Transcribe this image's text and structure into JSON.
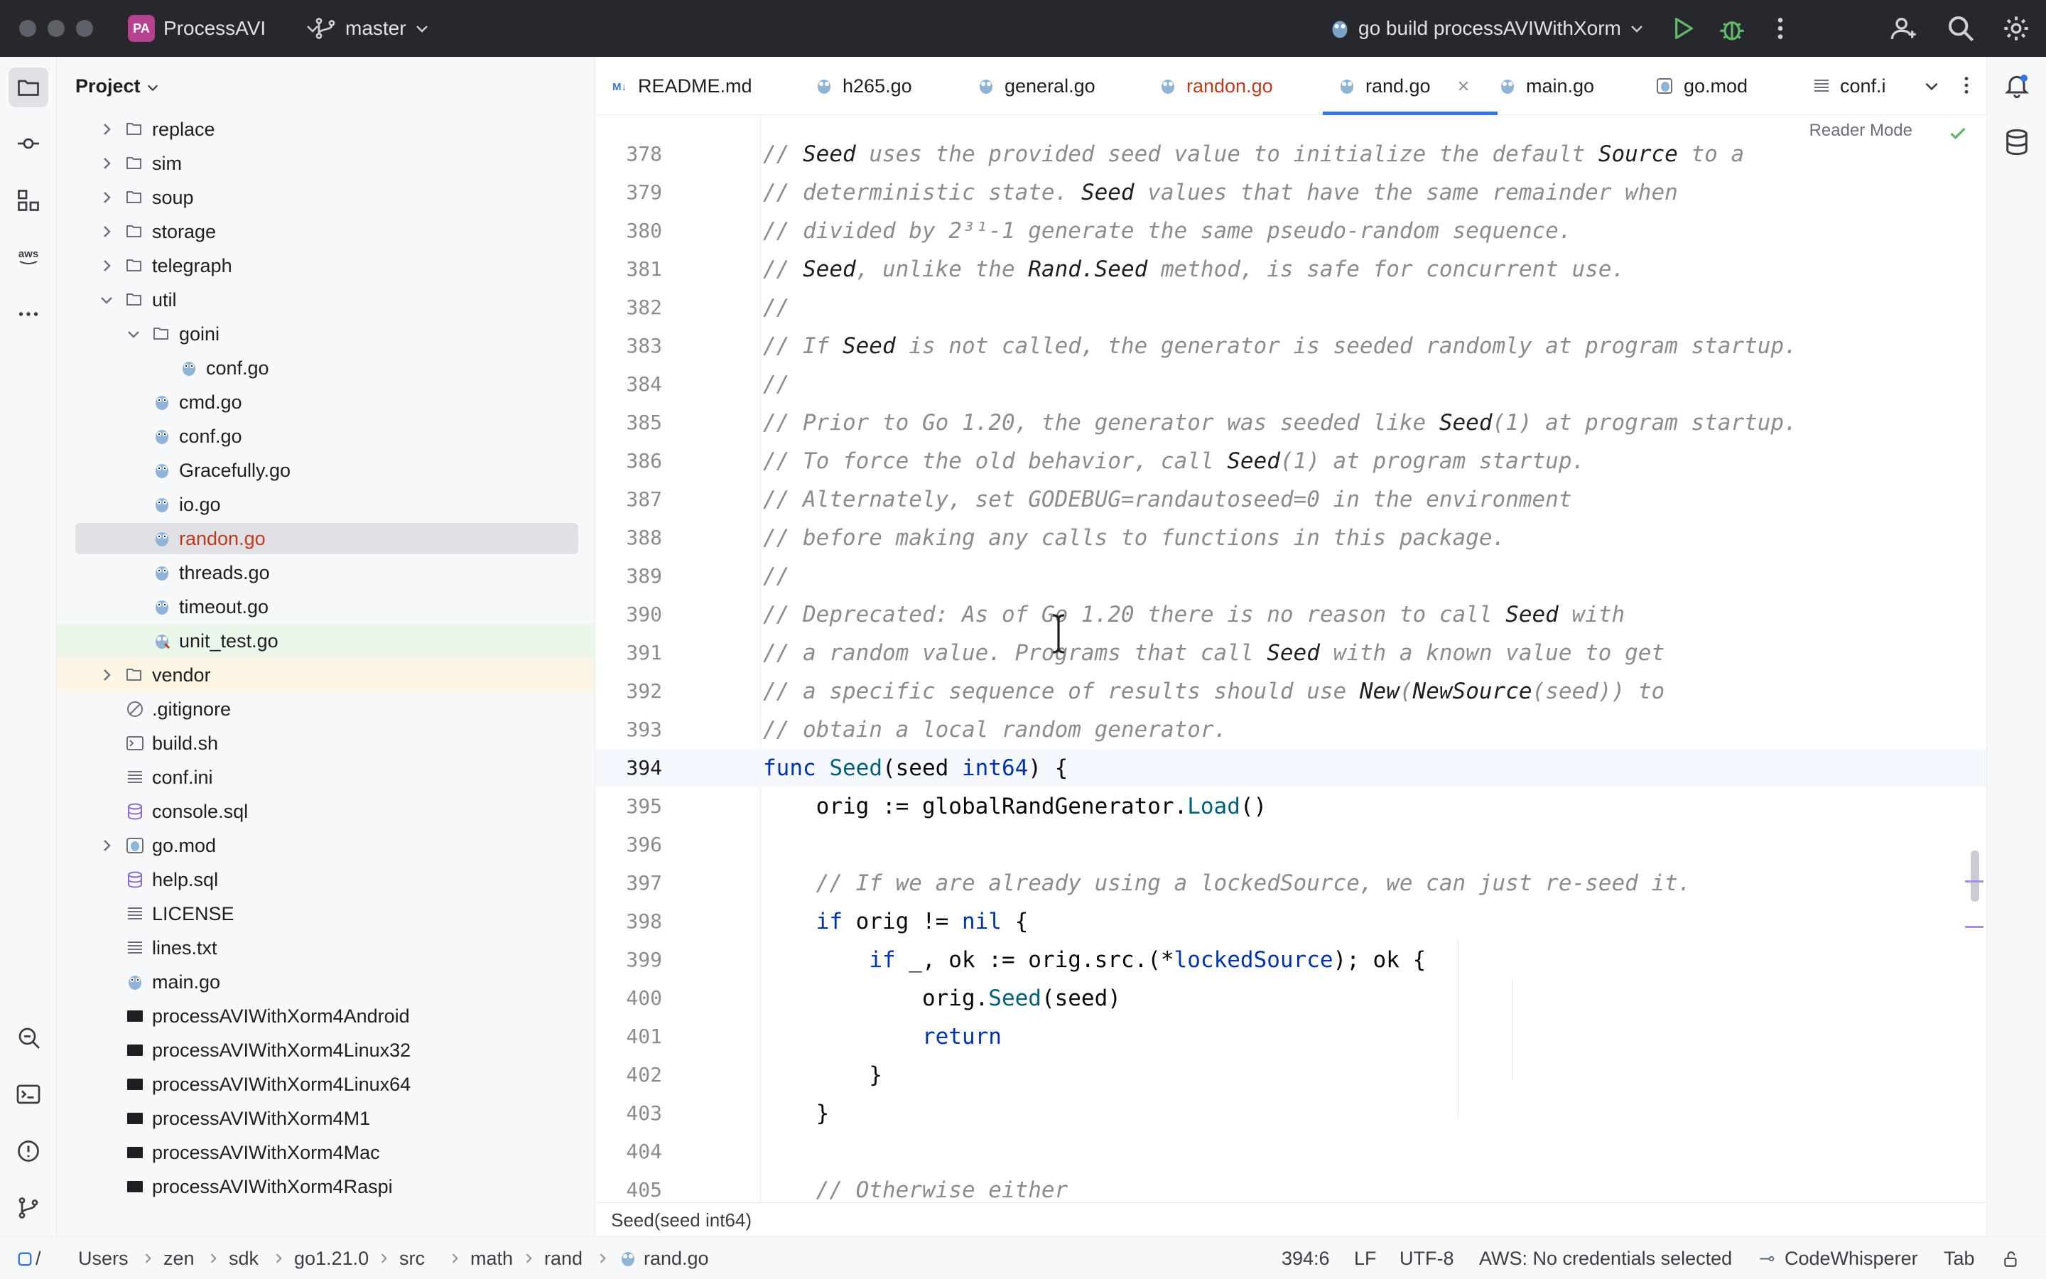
{
  "titlebar": {
    "project_badge": "PA",
    "project_name": "ProcessAVI",
    "branch": "master",
    "run_config": "go build processAVIWithXorm"
  },
  "project_panel": {
    "title": "Project",
    "items": [
      {
        "label": "replace"
      },
      {
        "label": "sim"
      },
      {
        "label": "soup"
      },
      {
        "label": "storage"
      },
      {
        "label": "telegraph"
      },
      {
        "label": "util"
      },
      {
        "label": "goini"
      },
      {
        "label": "conf.go"
      },
      {
        "label": "cmd.go"
      },
      {
        "label": "conf.go"
      },
      {
        "label": "Gracefully.go"
      },
      {
        "label": "io.go"
      },
      {
        "label": "randon.go"
      },
      {
        "label": "threads.go"
      },
      {
        "label": "timeout.go"
      },
      {
        "label": "unit_test.go"
      },
      {
        "label": "vendor"
      },
      {
        "label": ".gitignore"
      },
      {
        "label": "build.sh"
      },
      {
        "label": "conf.ini"
      },
      {
        "label": "console.sql"
      },
      {
        "label": "go.mod"
      },
      {
        "label": "help.sql"
      },
      {
        "label": "LICENSE"
      },
      {
        "label": "lines.txt"
      },
      {
        "label": "main.go"
      },
      {
        "label": "processAVIWithXorm4Android"
      },
      {
        "label": "processAVIWithXorm4Linux32"
      },
      {
        "label": "processAVIWithXorm4Linux64"
      },
      {
        "label": "processAVIWithXorm4M1"
      },
      {
        "label": "processAVIWithXorm4Mac"
      },
      {
        "label": "processAVIWithXorm4Raspi"
      }
    ]
  },
  "tabs": [
    {
      "label": "README.md"
    },
    {
      "label": "h265.go"
    },
    {
      "label": "general.go"
    },
    {
      "label": "randon.go"
    },
    {
      "label": "rand.go"
    },
    {
      "label": "main.go"
    },
    {
      "label": "go.mod"
    },
    {
      "label": "conf.i"
    }
  ],
  "editor": {
    "reader_mode": "Reader Mode",
    "lines": [
      {
        "n": "378"
      },
      {
        "n": "379"
      },
      {
        "n": "380"
      },
      {
        "n": "381"
      },
      {
        "n": "382"
      },
      {
        "n": "383"
      },
      {
        "n": "384"
      },
      {
        "n": "385"
      },
      {
        "n": "386"
      },
      {
        "n": "387"
      },
      {
        "n": "388"
      },
      {
        "n": "389"
      },
      {
        "n": "390"
      },
      {
        "n": "391"
      },
      {
        "n": "392"
      },
      {
        "n": "393"
      },
      {
        "n": "394"
      },
      {
        "n": "395"
      },
      {
        "n": "396"
      },
      {
        "n": "397"
      },
      {
        "n": "398"
      },
      {
        "n": "399"
      },
      {
        "n": "400"
      },
      {
        "n": "401"
      },
      {
        "n": "402"
      },
      {
        "n": "403"
      },
      {
        "n": "404"
      },
      {
        "n": "405"
      }
    ],
    "code": {
      "l378": [
        "// ",
        "Seed",
        " uses the provided seed value to initialize the default ",
        "Source",
        " to a"
      ],
      "l379": [
        "// deterministic state. ",
        "Seed",
        " values that have the same remainder when"
      ],
      "l380": [
        "// divided by 2³¹-1 generate the same pseudo-random sequence."
      ],
      "l381": [
        "// ",
        "Seed",
        ", unlike the ",
        "Rand.Seed",
        " method, is safe for concurrent use."
      ],
      "l382": [
        "//"
      ],
      "l383": [
        "// If ",
        "Seed",
        " is not called, the generator is seeded randomly at program startup."
      ],
      "l384": [
        "//"
      ],
      "l385": [
        "// Prior to Go 1.20, the generator was seeded like ",
        "Seed",
        "(1) at program startup."
      ],
      "l386": [
        "// To force the old behavior, call ",
        "Seed",
        "(1) at program startup."
      ],
      "l387": [
        "// Alternately, set GODEBUG=randautoseed=0 in the environment"
      ],
      "l388": [
        "// before making any calls to functions in this package."
      ],
      "l389": [
        "//"
      ],
      "l390": [
        "// Deprecated: As of Go 1.20 there is no reason to call ",
        "Seed",
        " with"
      ],
      "l391": [
        "// a random value. Programs that call ",
        "Seed",
        " with a known value to get"
      ],
      "l392": [
        "// a specific sequence of results should use ",
        "New",
        "(",
        "NewSource",
        "(seed)) to"
      ],
      "l393": [
        "// obtain a local random generator."
      ],
      "l394": [
        "func",
        " ",
        "Seed",
        "(seed ",
        "int64",
        ") {"
      ],
      "l395": [
        "    orig := globalRandGenerator.",
        "Load",
        "()"
      ],
      "l396": [
        ""
      ],
      "l397": [
        "    // If we are already using a lockedSource, we can just re-seed it."
      ],
      "l398": [
        "    ",
        "if",
        " orig != ",
        "nil",
        " {"
      ],
      "l399": [
        "        ",
        "if",
        " _, ok := orig.src.(*",
        "lockedSource",
        "); ok {"
      ],
      "l400": [
        "            orig.",
        "Seed",
        "(seed)"
      ],
      "l401": [
        "            ",
        "return"
      ],
      "l402": [
        "        }"
      ],
      "l403": [
        "    }"
      ],
      "l404": [
        ""
      ],
      "l405": [
        "    // Otherwise either"
      ]
    }
  },
  "hint": "Seed(seed int64)",
  "statusbar": {
    "breadcrumbs": [
      "Users",
      "zen",
      "sdk",
      "go1.21.0",
      "src",
      "math",
      "rand",
      "rand.go"
    ],
    "position": "394:6",
    "line_ending": "LF",
    "encoding": "UTF-8",
    "aws": "AWS: No credentials selected",
    "codewhisperer": "CodeWhisperer",
    "indent": "Tab"
  },
  "colors": {
    "titlebar": "#27282e",
    "accent": "#3574f0",
    "selected_row": "#dfe1e5",
    "modified_file": "#c4391b",
    "comment": "#8c8c8c",
    "keyword": "#0033b3",
    "function": "#00627a"
  }
}
